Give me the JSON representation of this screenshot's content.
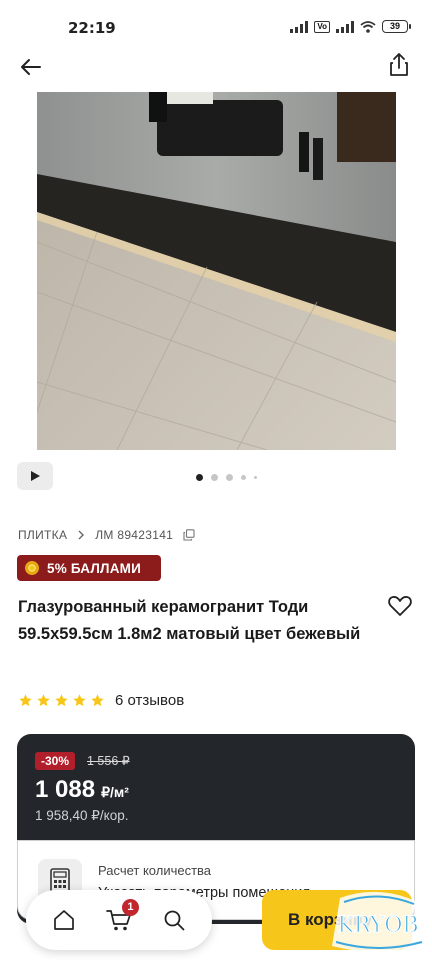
{
  "status_bar": {
    "time": "22:19",
    "battery": "39"
  },
  "product": {
    "breadcrumb_category": "ПЛИТКА",
    "sku": "ЛМ 89423141",
    "promo": "5% БАЛЛАМИ",
    "title": "Глазурованный керамогранит Тоди 59.5x59.5см 1.8м2 матовый цвет бежевый",
    "rating": 5,
    "reviews": "6 отзывов",
    "gallery": {
      "dots": 5,
      "active_index": 0
    }
  },
  "price": {
    "discount": "-30%",
    "old_price": "1 556 ₽",
    "current": "1 088",
    "unit": "₽/м²",
    "per_box": "1 958,40 ₽/кор."
  },
  "calc": {
    "title": "Расчет количества",
    "subtitle": "Указать параметры помещения"
  },
  "nav": {
    "cart_count": "1"
  },
  "cta": {
    "label": "В корзину"
  },
  "watermark": "KRYOB",
  "colors": {
    "accent": "#f7c61b",
    "promo": "#8c1c1c",
    "discount": "#b1202a",
    "card": "#23272b"
  }
}
